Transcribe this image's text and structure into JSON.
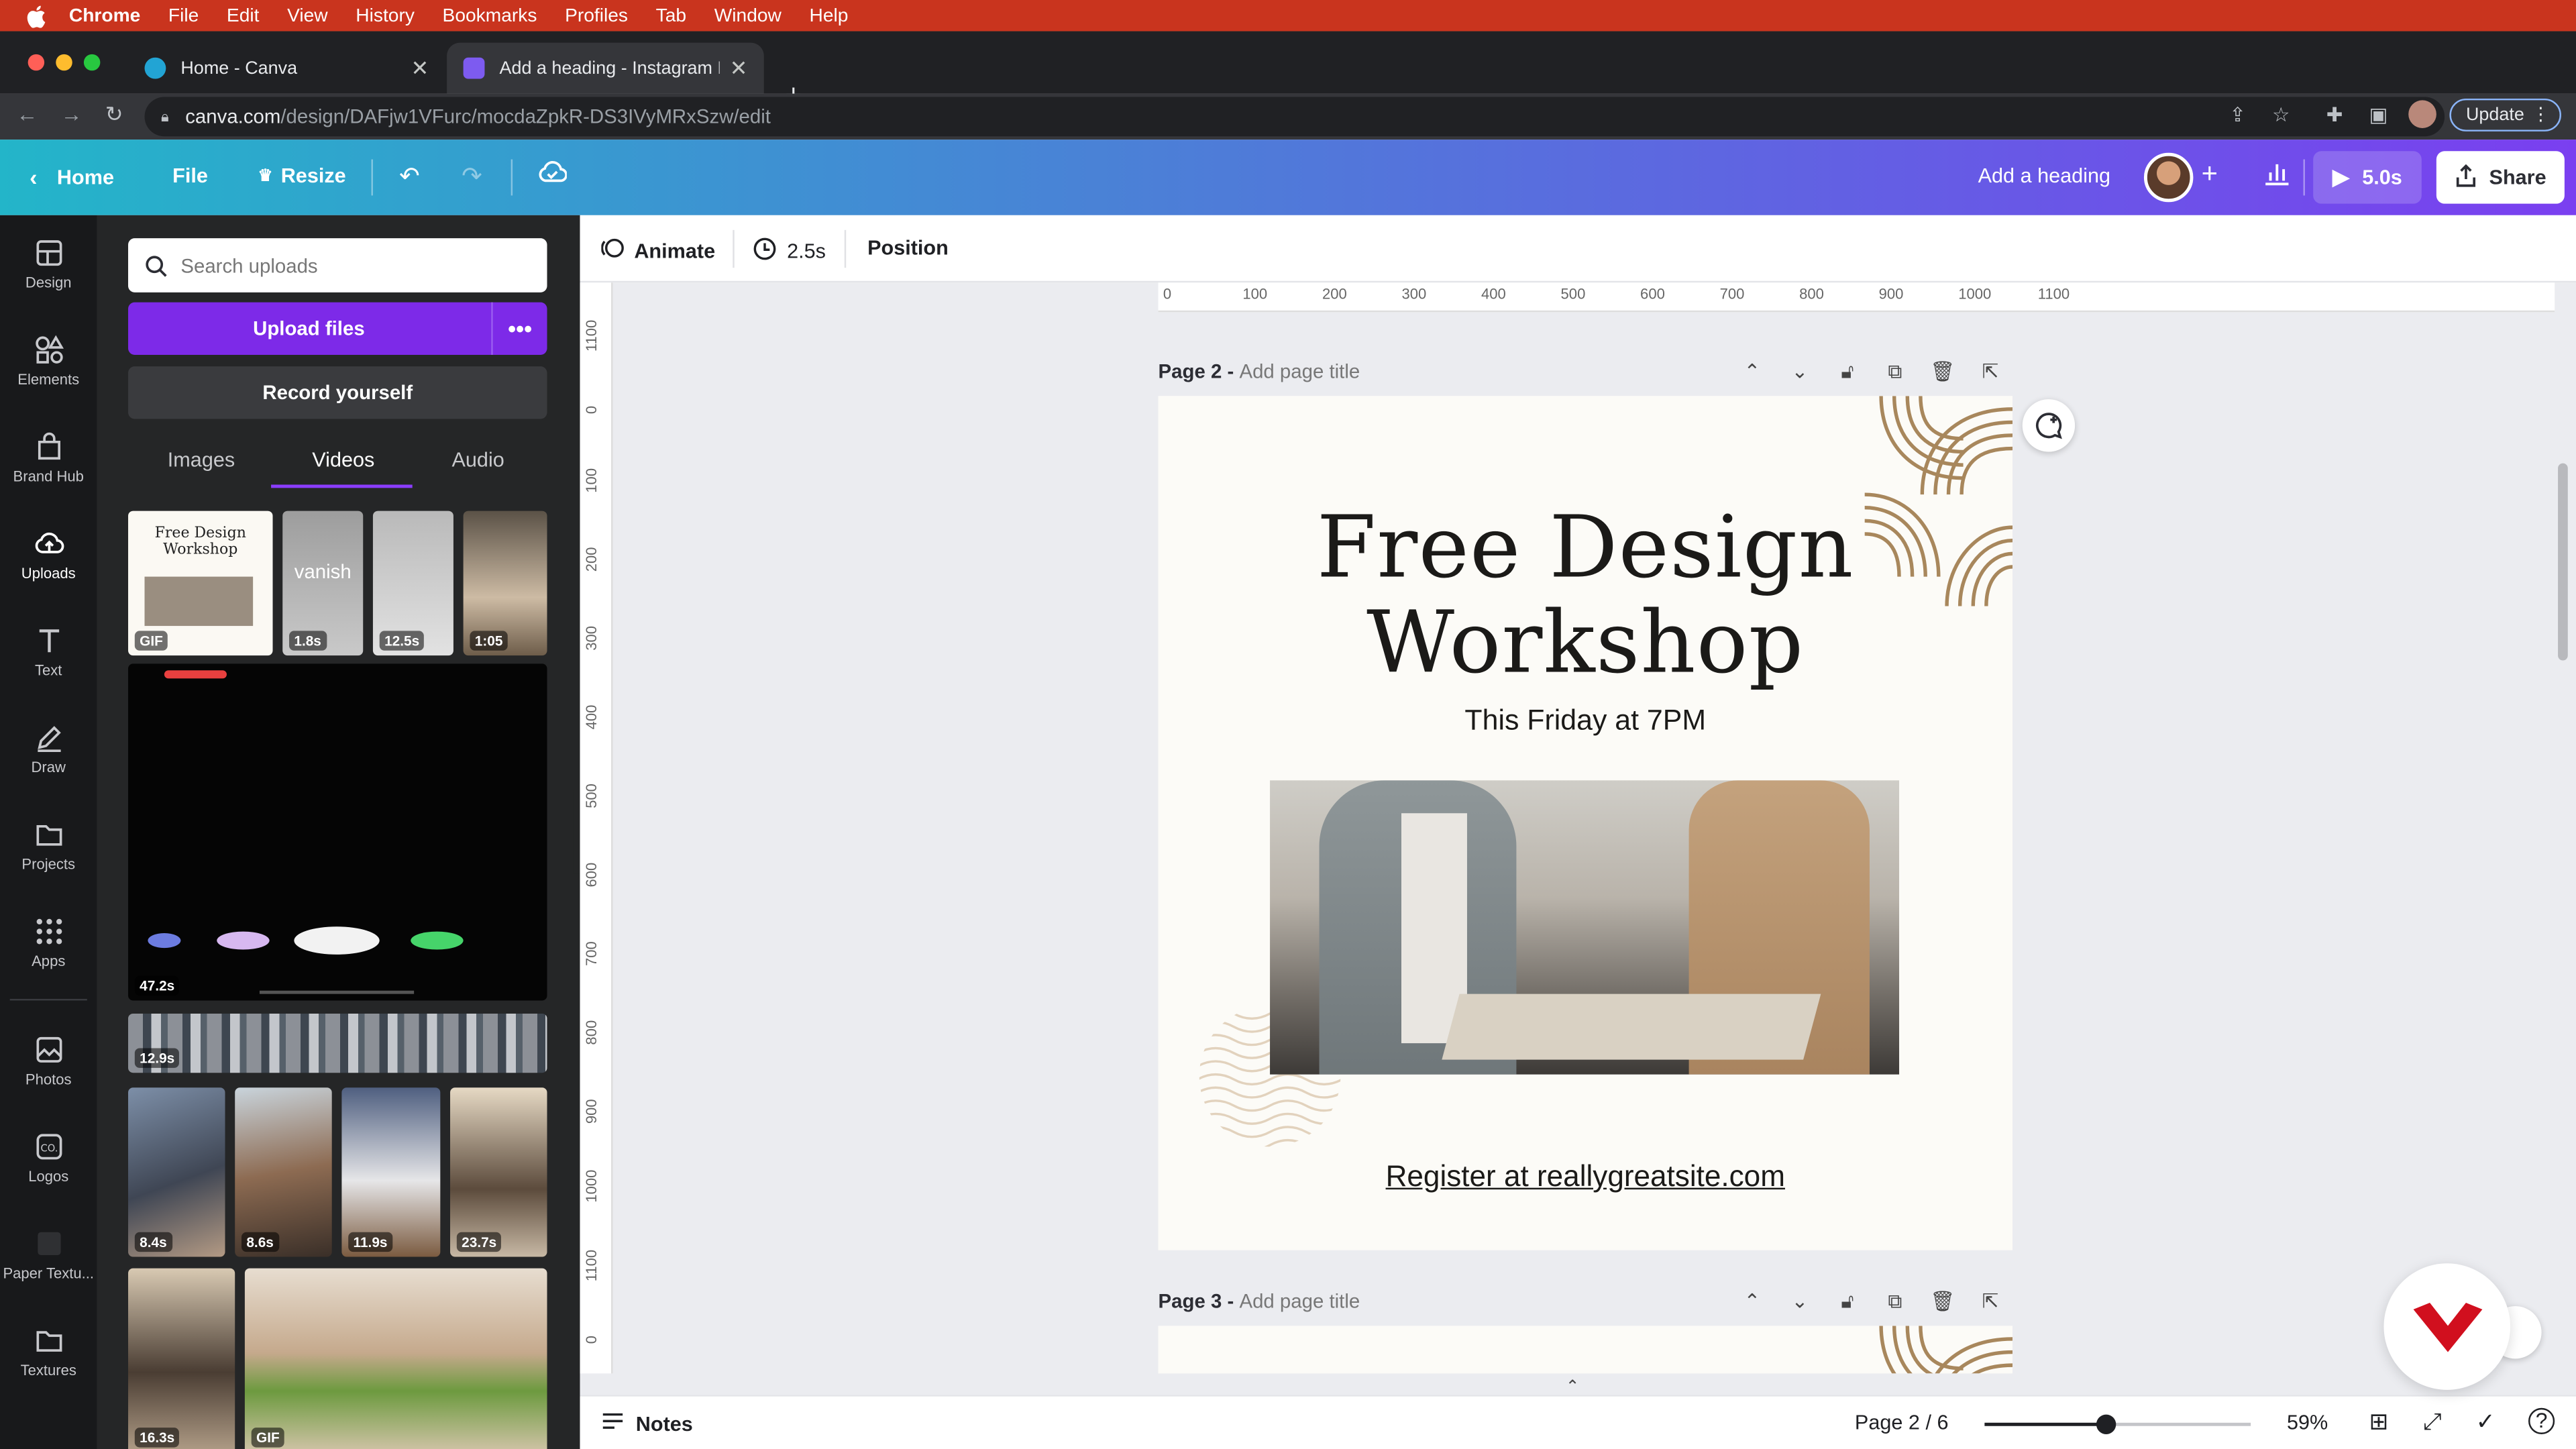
{
  "menubar": {
    "app": "Chrome",
    "items": [
      "File",
      "Edit",
      "View",
      "History",
      "Bookmarks",
      "Profiles",
      "Tab",
      "Window",
      "Help"
    ]
  },
  "browser": {
    "tabs": [
      {
        "title": "Home - Canva",
        "active": false
      },
      {
        "title": "Add a heading - Instagram Pos",
        "active": true
      }
    ],
    "url_host": "canva.com",
    "url_path": "/design/DAFjw1VFurc/mocdaZpkR-DS3IVyMRxSzw/edit",
    "update_label": "Update"
  },
  "topbar": {
    "home": "Home",
    "file": "File",
    "resize": "Resize",
    "design_title": "Add a heading",
    "play_time": "5.0s",
    "share": "Share"
  },
  "rail": {
    "items": [
      "Design",
      "Elements",
      "Brand Hub",
      "Uploads",
      "Text",
      "Draw",
      "Projects",
      "Apps",
      "Photos",
      "Logos",
      "Paper Textu...",
      "Textures"
    ]
  },
  "panel": {
    "search_placeholder": "Search uploads",
    "upload_label": "Upload files",
    "record_label": "Record yourself",
    "tabs": [
      "Images",
      "Videos",
      "Audio"
    ],
    "active_tab": "Videos",
    "thumb_mini_title": "Free Design Workshop",
    "thumb_vanish": "vanish",
    "durations": [
      "GIF",
      "1.8s",
      "12.5s",
      "1:05",
      "47.2s",
      "12.9s",
      "8.4s",
      "8.6s",
      "11.9s",
      "23.7s",
      "16.3s",
      "GIF"
    ]
  },
  "toolbar": {
    "animate": "Animate",
    "duration": "2.5s",
    "position": "Position"
  },
  "ruler": {
    "h_ticks": [
      "0",
      "100",
      "200",
      "300",
      "400",
      "500",
      "600",
      "700",
      "800",
      "900",
      "1000",
      "1100"
    ],
    "v_ticks": [
      "1100",
      "0",
      "100",
      "200",
      "300",
      "400",
      "500",
      "600",
      "700",
      "800",
      "900",
      "1000",
      "1100",
      "0"
    ]
  },
  "pages": [
    {
      "label": "Page 2 -",
      "placeholder": "Add page title"
    },
    {
      "label": "Page 3 -",
      "placeholder": "Add page title"
    }
  ],
  "design": {
    "title_line1": "Free Design",
    "title_line2": "Workshop",
    "subtitle": "This Friday at 7PM",
    "register": "Register at reallygreatsite.com"
  },
  "bottombar": {
    "notes": "Notes",
    "page_indicator": "Page 2 / 6",
    "zoom": "59%"
  },
  "colors": {
    "menubar": "#c9341e",
    "canva_gradient_start": "#23b5c9",
    "canva_gradient_end": "#7a3ff0",
    "upload_button": "#7d2ae8",
    "accent_tab": "#8b3dff",
    "page_bg": "#fcfbf7",
    "pattern": "#a8875c"
  }
}
